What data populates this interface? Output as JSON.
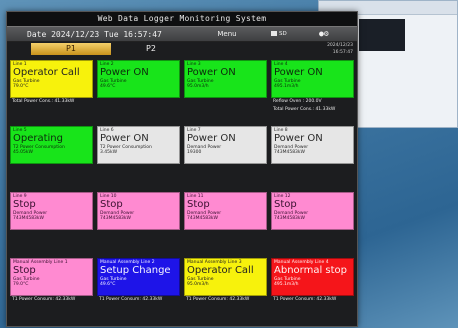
{
  "window": {
    "title": "Web Data Logger Monitoring System"
  },
  "header": {
    "date_text": "Date 2024/12/23 Tue 16:57:47",
    "menu_label": "Menu",
    "sd_label": "SD"
  },
  "tabs": [
    {
      "label": "P1",
      "active": true
    },
    {
      "label": "P2",
      "active": false
    }
  ],
  "corner": {
    "date": "2024/12/23",
    "time": "16:57:47"
  },
  "tiles": [
    {
      "line": "Line 1",
      "status": "Operator Call",
      "sub1": "Gas Turbine",
      "sub2": "79.0°C",
      "below": [
        "Total Power Cons.: 41.33kW"
      ],
      "color": "yellow"
    },
    {
      "line": "Line 2",
      "status": "Power ON",
      "sub1": "Gas Turbine",
      "sub2": "49.6°C",
      "below": [],
      "color": "green"
    },
    {
      "line": "Line 3",
      "status": "Power ON",
      "sub1": "Gas Turbine",
      "sub2": "95.0m3/h",
      "below": [],
      "color": "green"
    },
    {
      "line": "Line 4",
      "status": "Power ON",
      "sub1": "Gas Turbine",
      "sub2": "495.1m3/h",
      "below": [
        "Reflow Oven    : 200.0V",
        "Total Power Cons.: 41.33kW"
      ],
      "color": "green"
    },
    {
      "line": "Line 5",
      "status": "Operating",
      "sub1": "T2 Power Consumption",
      "sub2": "45.05kW",
      "below": [],
      "color": "green"
    },
    {
      "line": "Line 6",
      "status": "Power ON",
      "sub1": "T2 Power Consumption",
      "sub2": "3.45kW",
      "below": [],
      "color": "white"
    },
    {
      "line": "Line 7",
      "status": "Power ON",
      "sub1": "Demand Power",
      "sub2": "19300",
      "below": [],
      "color": "white"
    },
    {
      "line": "Line 8",
      "status": "Power ON",
      "sub1": "Demand Power",
      "sub2": "743M4583kW",
      "below": [],
      "color": "white"
    },
    {
      "line": "Line 9",
      "status": "Stop",
      "sub1": "Demand Power",
      "sub2": "743M4583kW",
      "below": [],
      "color": "pink"
    },
    {
      "line": "Line 10",
      "status": "Stop",
      "sub1": "Demand Power",
      "sub2": "743M4583kW",
      "below": [],
      "color": "pink"
    },
    {
      "line": "Line 11",
      "status": "Stop",
      "sub1": "Demand Power",
      "sub2": "743M4583kW",
      "below": [],
      "color": "pink"
    },
    {
      "line": "Line 12",
      "status": "Stop",
      "sub1": "Demand Power",
      "sub2": "743M4583kW",
      "below": [],
      "color": "pink"
    },
    {
      "line": "Manual Assembly Line 1",
      "status": "Stop",
      "sub1": "Gas Turbine",
      "sub2": "79.0°C",
      "below": [
        "T1 Power Consum: 42.33kW"
      ],
      "color": "pink"
    },
    {
      "line": "Manual Assembly Line 2",
      "status": "Setup Change",
      "sub1": "Gas Turbine",
      "sub2": "49.6°C",
      "below": [
        "T1 Power Consum: 42.33kW"
      ],
      "color": "blue"
    },
    {
      "line": "Manual Assembly Line 3",
      "status": "Operator Call",
      "sub1": "Gas Turbine",
      "sub2": "95.0m3/h",
      "below": [
        "T1 Power Consum: 42.33kW"
      ],
      "color": "yellow"
    },
    {
      "line": "Manual Assembly Line 4",
      "status": "Abnormal stop",
      "sub1": "Gas Turbine",
      "sub2": "495.1m3/h",
      "below": [
        "T1 Power Consum: 42.33kW"
      ],
      "color": "red"
    }
  ]
}
